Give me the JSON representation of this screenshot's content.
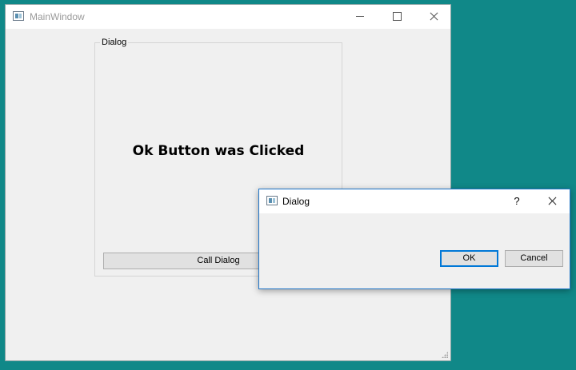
{
  "main_window": {
    "title": "MainWindow",
    "icon": "app-window-icon",
    "caption_buttons": [
      "minimize-icon",
      "maximize-icon",
      "close-icon"
    ]
  },
  "group": {
    "title": "Dialog",
    "status_text": "Ok Button was Clicked",
    "call_button_label": "Call Dialog"
  },
  "dialog": {
    "title": "Dialog",
    "help_label": "?",
    "ok_label": "OK",
    "cancel_label": "Cancel"
  },
  "colors": {
    "desktop": "#108888",
    "window_bg": "#f0f0f0",
    "focus_border": "#0078d7"
  }
}
